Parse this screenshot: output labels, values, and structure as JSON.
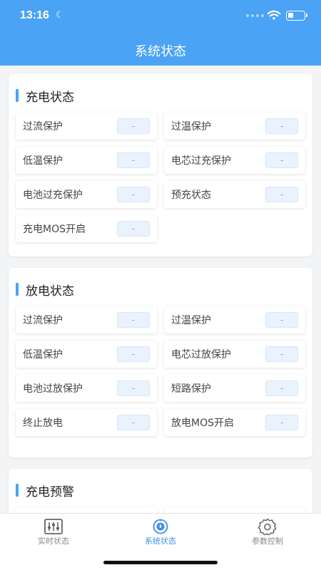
{
  "status_bar": {
    "time": "13:16"
  },
  "header": {
    "title": "系统状态"
  },
  "sections": [
    {
      "title": "充电状态",
      "items": [
        {
          "label": "过流保护",
          "value": "-"
        },
        {
          "label": "过温保护",
          "value": "-"
        },
        {
          "label": "低温保护",
          "value": "-"
        },
        {
          "label": "电芯过充保护",
          "value": "-"
        },
        {
          "label": "电池过充保护",
          "value": "-"
        },
        {
          "label": "预充状态",
          "value": "-"
        },
        {
          "label": "充电MOS开启",
          "value": "-"
        }
      ]
    },
    {
      "title": "放电状态",
      "items": [
        {
          "label": "过流保护",
          "value": "-"
        },
        {
          "label": "过温保护",
          "value": "-"
        },
        {
          "label": "低温保护",
          "value": "-"
        },
        {
          "label": "电芯过放保护",
          "value": "-"
        },
        {
          "label": "电池过放保护",
          "value": "-"
        },
        {
          "label": "短路保护",
          "value": "-"
        },
        {
          "label": "终止放电",
          "value": "-"
        },
        {
          "label": "放电MOS开启",
          "value": "-"
        }
      ]
    },
    {
      "title": "充电预警",
      "items": []
    }
  ],
  "tabbar": {
    "tabs": [
      {
        "label": "实时状态",
        "icon": "sliders-icon",
        "active": false
      },
      {
        "label": "系统状态",
        "icon": "gauge-icon",
        "active": true
      },
      {
        "label": "参数控制",
        "icon": "gear-icon",
        "active": false
      }
    ]
  },
  "colors": {
    "accent": "#4aa3f5",
    "active_tab": "#3f8fe8",
    "value_bg": "#eaf3fd"
  }
}
